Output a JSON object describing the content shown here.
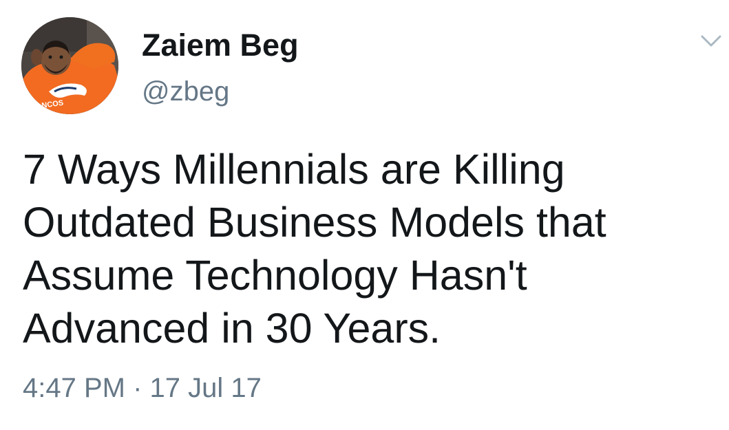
{
  "tweet": {
    "author": {
      "display_name": "Zaiem Beg",
      "handle": "@zbeg",
      "avatar_icon": "user-avatar-photo",
      "avatar_shirt_text": "NCOS"
    },
    "text_lines": [
      "7 Ways Millennials are Killing",
      "Outdated Business Models that",
      "Assume Technology Hasn't",
      "Advanced in 30 Years."
    ],
    "timestamp": "4:47 PM · 17 Jul 17",
    "menu_icon": "chevron-down-icon"
  },
  "colors": {
    "primary_text": "#14171a",
    "secondary_text": "#657786",
    "avatar_shirt": "#f26b21",
    "background": "#ffffff"
  }
}
